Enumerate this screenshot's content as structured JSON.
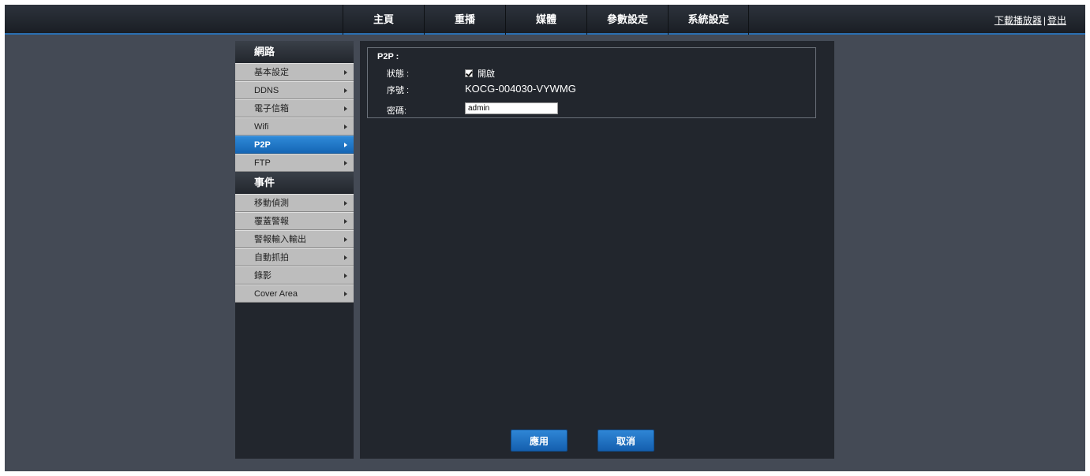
{
  "nav": {
    "items": [
      "主頁",
      "重播",
      "媒體",
      "參數設定",
      "系統設定"
    ]
  },
  "top_links": {
    "download": "下載播放器",
    "separator": "|",
    "logout": "登出"
  },
  "sidebar": {
    "network_header": "網路",
    "network_items": [
      {
        "label": "基本設定"
      },
      {
        "label": "DDNS"
      },
      {
        "label": "電子信箱"
      },
      {
        "label": "Wifi"
      },
      {
        "label": "P2P",
        "active": true
      },
      {
        "label": "FTP"
      }
    ],
    "event_header": "事件",
    "event_items": [
      {
        "label": "移動偵測"
      },
      {
        "label": "覆蓋警報"
      },
      {
        "label": "警報輸入輸出"
      },
      {
        "label": "自動抓拍"
      },
      {
        "label": "錄影"
      },
      {
        "label": "Cover Area"
      }
    ]
  },
  "p2p": {
    "title": "P2P :",
    "status_label": "狀態 :",
    "status_checked": true,
    "status_value": "開啟",
    "serial_label": "序號 :",
    "serial_value": "KOCG-004030-VYWMG",
    "password_label": "密碼:",
    "password_value": "admin"
  },
  "buttons": {
    "apply": "應用",
    "cancel": "取消"
  },
  "colors": {
    "accent": "#1f74c4",
    "background": "#444a55",
    "panel": "#22262d"
  }
}
